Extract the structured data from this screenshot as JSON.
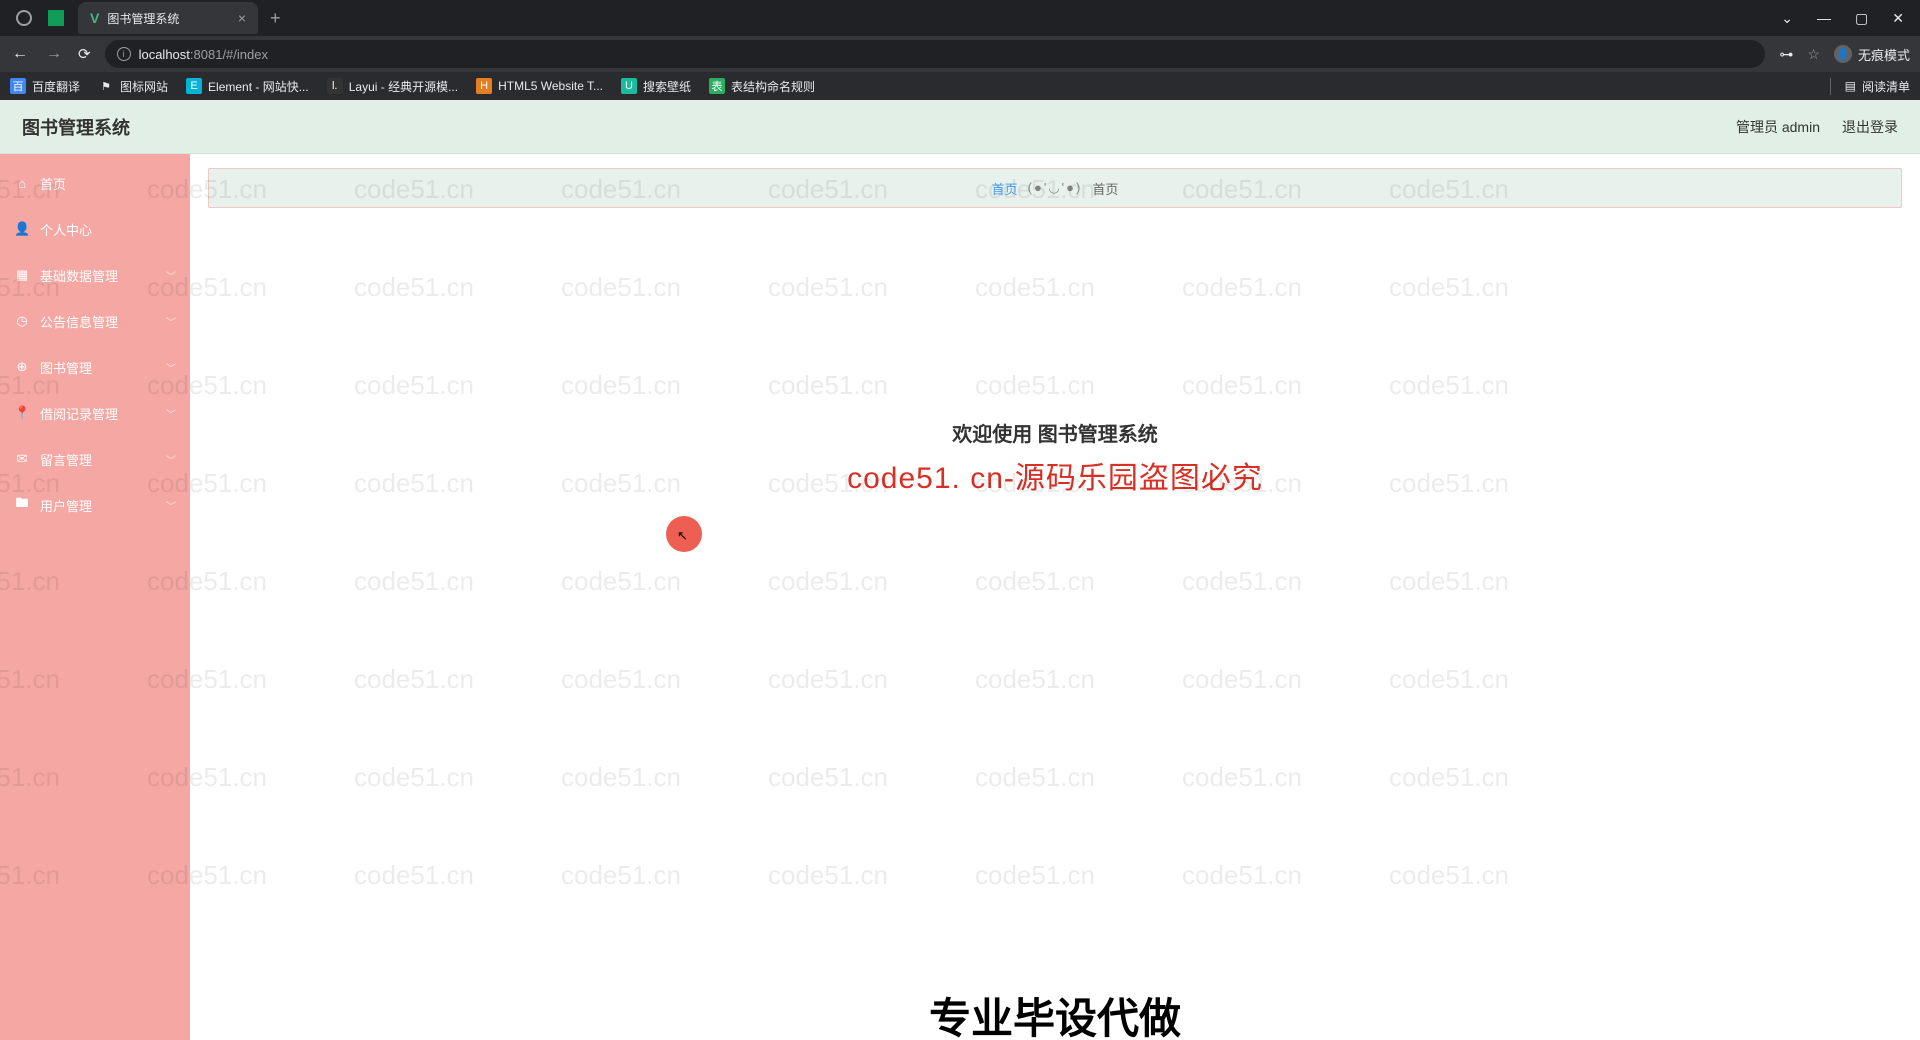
{
  "browser": {
    "tab_title": "图书管理系统",
    "url_host": "localhost",
    "url_port": ":8081",
    "url_path": "/#/index",
    "incognito_label": "无痕模式",
    "reading_list": "阅读清单"
  },
  "bookmarks": [
    {
      "label": "百度翻译"
    },
    {
      "label": "图标网站"
    },
    {
      "label": "Element - 网站快..."
    },
    {
      "label": "Layui - 经典开源模..."
    },
    {
      "label": "HTML5 Website T..."
    },
    {
      "label": "搜索壁纸"
    },
    {
      "label": "表结构命名规则"
    }
  ],
  "header": {
    "title": "图书管理系统",
    "admin_label": "管理员 admin",
    "logout_label": "退出登录"
  },
  "sidebar": {
    "items": [
      {
        "label": "首页",
        "icon": "home",
        "has_arrow": false
      },
      {
        "label": "个人中心",
        "icon": "user",
        "has_arrow": false
      },
      {
        "label": "基础数据管理",
        "icon": "grid",
        "has_arrow": true
      },
      {
        "label": "公告信息管理",
        "icon": "clock",
        "has_arrow": true
      },
      {
        "label": "图书管理",
        "icon": "globe",
        "has_arrow": true
      },
      {
        "label": "借阅记录管理",
        "icon": "pin",
        "has_arrow": true
      },
      {
        "label": "留言管理",
        "icon": "mail",
        "has_arrow": true
      },
      {
        "label": "用户管理",
        "icon": "folder",
        "has_arrow": true
      }
    ]
  },
  "breadcrumb": {
    "home": "首页",
    "face": "(●'◡'●)",
    "current": "首页"
  },
  "main": {
    "welcome": "欢迎使用 图书管理系统",
    "watermark_text": "code51. cn-源码乐园盗图必究",
    "bottom_banner": "专业毕设代做"
  },
  "watermark": "code51.cn"
}
